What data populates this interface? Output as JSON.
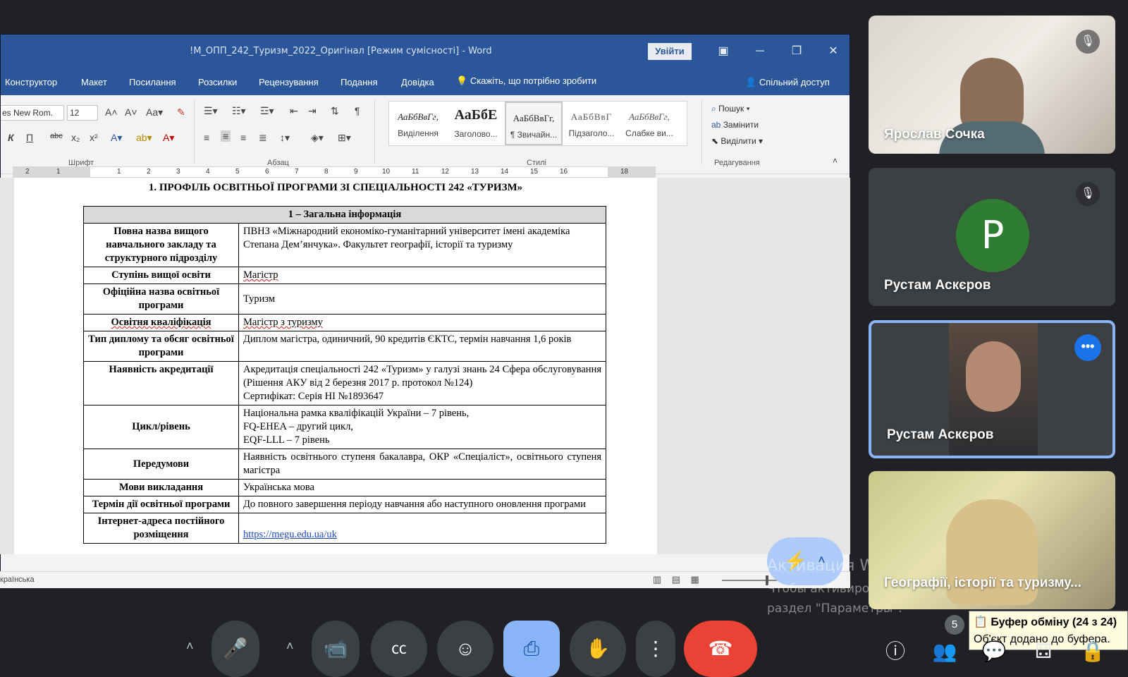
{
  "word": {
    "title": "!М_ОПП_242_Туризм_2022_Оригінал [Режим сумісності]  -  Word",
    "signin": "Увійти",
    "tabs": [
      "Конструктор",
      "Макет",
      "Посилання",
      "Розсилки",
      "Рецензування",
      "Подання",
      "Довідка"
    ],
    "tell_me": "Скажіть, що потрібно зробити",
    "share": "Спільний доступ",
    "font_name": "es New Rom.",
    "font_size": "12",
    "groups": {
      "font": "Шрифт",
      "paragraph": "Абзац",
      "styles": "Стилі",
      "editing": "Редагування"
    },
    "styles": [
      {
        "sample": "АаБбВвГг,",
        "name": "Виділення"
      },
      {
        "sample": "АаБбЕ",
        "name": "Заголово..."
      },
      {
        "sample": "АаБбВвГг,",
        "name": "¶ Звичайн..."
      },
      {
        "sample": "АаБбВвГ",
        "name": "Підзаголо..."
      },
      {
        "sample": "АаБбВвГг,",
        "name": "Слабке ви..."
      }
    ],
    "editing": {
      "find": "Пошук",
      "replace": "Замінити",
      "select": "Виділити"
    },
    "ruler": [
      "2",
      "1",
      "1",
      "2",
      "3",
      "4",
      "5",
      "6",
      "7",
      "8",
      "9",
      "10",
      "11",
      "12",
      "13",
      "14",
      "15",
      "16",
      "18"
    ],
    "status_lang": "країнська"
  },
  "doc": {
    "heading": "1. ПРОФІЛЬ ОСВІТНЬОЇ ПРОГРАМИ ЗІ СПЕЦІАЛЬНОСТІ 242 «ТУРИЗМ»",
    "section": "1 – Загальна інформація",
    "rows": [
      {
        "k": "Повна назва вищого навчального закладу та структурного підрозділу",
        "v": "ПВНЗ «Міжнародний економіко-гуманітарний університет імені академіка Степана Дем’янчука». Факультет географії, історії та туризму"
      },
      {
        "k": "Ступінь вищої освіти",
        "v": "Магістр"
      },
      {
        "k": "Офіційна назва освітньої програми",
        "v": "Туризм"
      },
      {
        "k": "Освітня кваліфікація",
        "v": "Магістр з туризму"
      },
      {
        "k": "Тип диплому та обсяг освітньої програми",
        "v": "Диплом магістра, одиничний, 90 кредитів ЄКТС, термін навчання 1,6 років"
      },
      {
        "k": "Наявність акредитації",
        "v": "Акредитація спеціальності 242 «Туризм» у галузі знань 24 Сфера обслуговування (Рішення АКУ від 2 березня 2017 р. протокол №124)",
        "v2": "Сертифікат: Серія НІ №1893647"
      },
      {
        "k": "Цикл/рівень",
        "v": "Національна рамка кваліфікацій України – 7 рівень,",
        "v2": "FQ-EHEA – другий цикл,",
        "v3": "EQF-LLL – 7 рівень"
      },
      {
        "k": "Передумови",
        "v": "Наявність освітнього ступеня бакалавра, ОКР «Спеціаліст», освітнього ступеня магістра"
      },
      {
        "k": "Мови викладання",
        "v": "Українська мова"
      },
      {
        "k": "Термін дії освітньої програми",
        "v": "До повного завершення періоду навчання або наступного оновлення програми"
      },
      {
        "k": "Інтернет-адреса постійного розміщення",
        "v": "https://megu.edu.ua/uk"
      }
    ]
  },
  "watermark": {
    "line1": "Активация Windows",
    "line2": "Чтобы активировать Windows, перейдите в",
    "line3": "раздел \"Параметры\"."
  },
  "participants": [
    {
      "name": "Ярослав Сочка"
    },
    {
      "name": "Рустам Аскєров",
      "initial": "Р"
    },
    {
      "name": "Рустам Аскєров"
    },
    {
      "name": "Географії, історії та туризму..."
    }
  ],
  "clipboard": {
    "title": "Буфер обміну (24 з 24)",
    "message": "Об'єкт додано до буфера."
  },
  "people_count": "5",
  "colors": {
    "word_blue": "#2b579a",
    "meet_bg": "#202124",
    "end_call": "#ea4335",
    "present_active": "#8ab4f8"
  }
}
